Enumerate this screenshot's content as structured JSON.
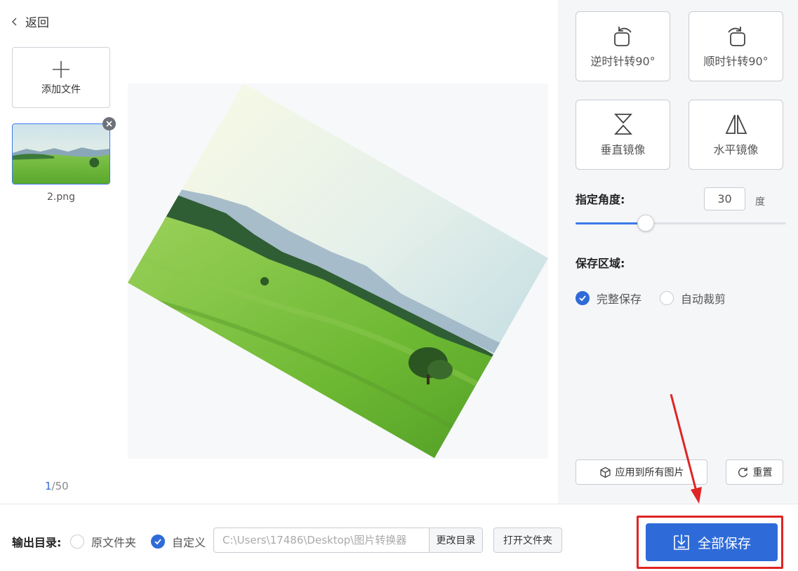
{
  "nav": {
    "back_label": "返回"
  },
  "files": {
    "add_label": "添加文件",
    "items": [
      {
        "name": "2.png"
      }
    ],
    "page_current": "1",
    "page_sep_total": "/50"
  },
  "panel": {
    "rotate_ccw_label": "逆时针转90°",
    "rotate_cw_label": "顺时针转90°",
    "flip_vertical_label": "垂直镜像",
    "flip_horizontal_label": "水平镜像",
    "angle_label": "指定角度:",
    "angle_value": "30",
    "angle_unit": "度",
    "angle_slider": {
      "min": 0,
      "max": 360,
      "value": 30
    },
    "save_area_label": "保存区域:",
    "save_area_options": [
      {
        "label": "完整保存",
        "selected": true
      },
      {
        "label": "自动裁剪",
        "selected": false
      }
    ],
    "apply_all_label": "应用到所有图片",
    "reset_label": "重置"
  },
  "output": {
    "label": "输出目录:",
    "options": [
      {
        "label": "原文件夹",
        "selected": false
      },
      {
        "label": "自定义",
        "selected": true
      }
    ],
    "path_placeholder": "C:\\Users\\17486\\Desktop\\图片转换器",
    "change_label": "更改目录",
    "open_label": "打开文件夹",
    "save_all_label": "全部保存"
  },
  "colors": {
    "accent": "#2f6bd8",
    "highlight": "#e02424"
  }
}
